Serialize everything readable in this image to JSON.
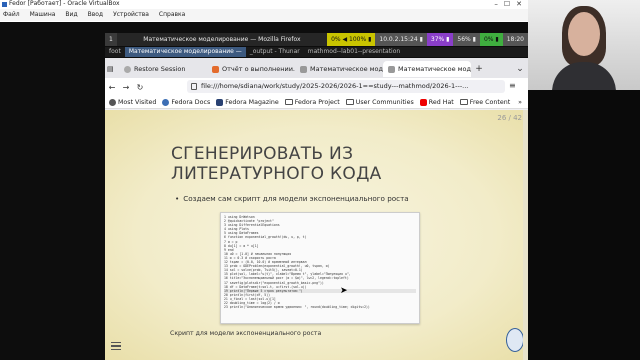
{
  "vbox": {
    "title": "Fedor [Работает] - Oracle VirtualBox",
    "menu": [
      "Файл",
      "Машина",
      "Вид",
      "Ввод",
      "Устройства",
      "Справка"
    ],
    "controls": [
      "–",
      "☐",
      "✕"
    ]
  },
  "guest_panel": {
    "workspace": "1",
    "window_title": "Математическое моделирование — Mozilla Firefox",
    "indicators": [
      "0% ◀ 100% ▮",
      "10.0.2.15:24 ▮",
      "37% ▮",
      "56% ▮",
      "0% ▮",
      "18:20"
    ]
  },
  "guest_tasks": [
    "foot",
    "Математическое моделирование — ",
    "_output - Thunar",
    "mathmod--lab01--presentation"
  ],
  "firefox": {
    "tabs": [
      {
        "label": "Restore Session"
      },
      {
        "label": "Отчёт о выполнении..."
      },
      {
        "label": "Математическое модел..."
      },
      {
        "label": "Математическое модел..."
      }
    ],
    "nav": {
      "back": "←",
      "forward": "→",
      "reload": "↻"
    },
    "url": "file:///home/sdiana/work/study/2025-2026/2026-1==study---mathmod/2026-1---...",
    "bookmarks": [
      {
        "label": "Most Visited",
        "icon": "gear-icon"
      },
      {
        "label": "Fedora Docs",
        "icon": "fedora-icon"
      },
      {
        "label": "Fedora Magazine",
        "icon": "magazine-icon"
      },
      {
        "label": "Fedora Project",
        "icon": "folder-icon"
      },
      {
        "label": "User Communities",
        "icon": "folder-icon"
      },
      {
        "label": "Red Hat",
        "icon": "redhat-icon"
      },
      {
        "label": "Free Content",
        "icon": "folder-icon"
      }
    ],
    "more": "»"
  },
  "slide": {
    "counter": "26 / 42",
    "title": "СГЕНЕРИРОВАТЬ ИЗ ЛИТЕРАТУРНОГО КОДА",
    "bullet": "Создаем сам скрипт для модели экспоненциального роста",
    "caption": "Скрипт для модели экспоненциального роста",
    "code_lines": [
      "1 using DrWatson",
      "2 @quickactivate \"project\"",
      "3 using DifferentialEquations",
      "4 using Plots",
      "5 using DataFrames",
      "6 function exponential_growth!(du, u, p, t)",
      "7   α = p",
      "8   du[1] = α * u[1]",
      "9 end",
      "10 u0 = [1.0]  # начальная популяция",
      "11 α = 0.3     # скорость роста",
      "12 tspan = (0.0, 10.0)  # временной интервал",
      "13 prob = ODEProblem(exponential_growth!, u0, tspan, α)",
      "14 sol = solve(prob, Tsit5(), saveat=0.1)",
      "15 plot(sol, label=\"u(t)\", xlabel=\"Время t\", ylabel=\"Популяция u\",",
      "16   title=\"Экспоненциальный рост (α = $α)\", lw=2, legend=:topleft)",
      "17 savefig(plotsdir(\"exponential_growth_basic.png\"))",
      "18 df = DataFrame(t=sol.t, u=first.(sol.u))",
      "19 println(\"Первые 5 строк результатов:\")",
      "20 println(first(df, 5))",
      "21 u_final = last(sol.u)[1]",
      "22 doubling_time = log(2) / α",
      "23 println(\"Аналитическое время удвоения: \", round(doubling_time; digits=2))"
    ]
  }
}
